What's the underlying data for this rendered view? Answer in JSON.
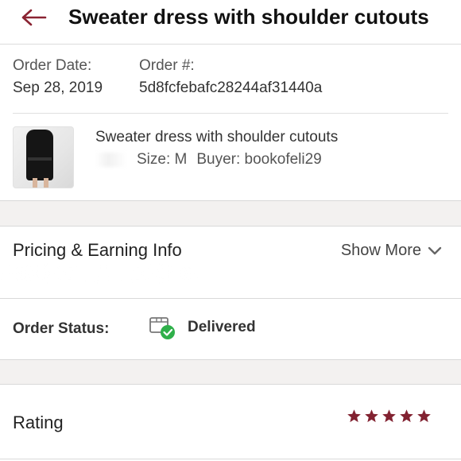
{
  "header": {
    "back_icon": "back-arrow-icon",
    "title": "Sweater dress with shoulder cutouts",
    "accent_color": "#8a2332"
  },
  "order": {
    "date_label": "Order Date:",
    "date_value": "Sep 28, 2019",
    "number_label": "Order #:",
    "number_value": "5d8fcfebafc28244af31440a"
  },
  "item": {
    "thumbnail_icon": "product-thumbnail",
    "title": "Sweater dress with shoulder cutouts",
    "size": "Size: M",
    "buyer": "Buyer: bookofeli29"
  },
  "pricing": {
    "title": "Pricing & Earning Info",
    "show_more": "Show More",
    "chevron_icon": "chevron-down-icon"
  },
  "status": {
    "label": "Order Status:",
    "value": "Delivered",
    "icon": "delivered-box-icon",
    "check_color": "#2fb04a"
  },
  "rating": {
    "label": "Rating",
    "stars": 5,
    "max_stars": 5,
    "star_color": "#822231"
  }
}
